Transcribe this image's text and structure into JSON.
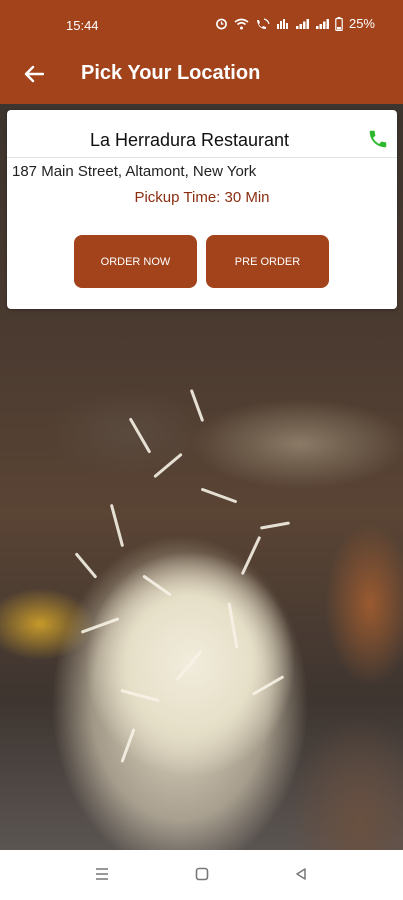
{
  "status_bar": {
    "time": "15:44",
    "battery": "25%",
    "icons": [
      "alarm-icon",
      "wifi-icon",
      "wifi-call-icon",
      "volte-icon",
      "signal-icon",
      "signal-icon",
      "battery-icon"
    ]
  },
  "app_bar": {
    "title": "Pick Your Location",
    "back_icon": "arrow-left-icon"
  },
  "restaurant": {
    "name": "La Herradura Restaurant",
    "address": "187 Main Street, Altamont, New York",
    "pickup_time": "Pickup Time: 30 Min",
    "phone_icon": "phone-icon",
    "phone_color": "#2EB82E"
  },
  "actions": {
    "order_now": "ORDER NOW",
    "pre_order": "PRE ORDER"
  },
  "nav_bar": {
    "icons": [
      "menu-icon",
      "home-icon",
      "back-icon"
    ]
  },
  "colors": {
    "primary": "#A2431C",
    "pickup_text": "#8A2E12"
  }
}
